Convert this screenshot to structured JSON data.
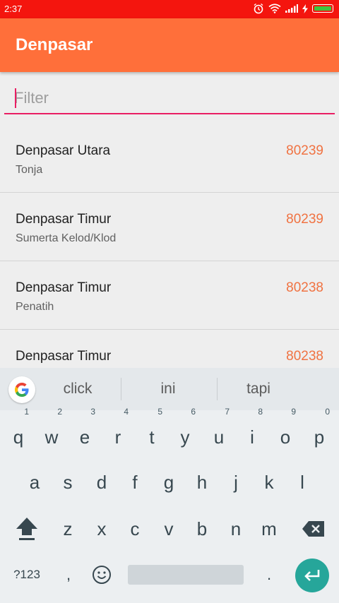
{
  "status": {
    "time": "2:37"
  },
  "appbar": {
    "title": "Denpasar"
  },
  "filter": {
    "placeholder": "Filter",
    "value": ""
  },
  "items": [
    {
      "title": "Denpasar Utara",
      "subtitle": "Tonja",
      "code": "80239"
    },
    {
      "title": "Denpasar Timur",
      "subtitle": "Sumerta Kelod/Klod",
      "code": "80239"
    },
    {
      "title": "Denpasar Timur",
      "subtitle": "Penatih",
      "code": "80238"
    },
    {
      "title": "Denpasar Timur",
      "subtitle": "",
      "code": "80238"
    }
  ],
  "keyboard": {
    "suggestions": [
      "click",
      "ini",
      "tapi"
    ],
    "row1": [
      {
        "k": "q",
        "n": "1"
      },
      {
        "k": "w",
        "n": "2"
      },
      {
        "k": "e",
        "n": "3"
      },
      {
        "k": "r",
        "n": "4"
      },
      {
        "k": "t",
        "n": "5"
      },
      {
        "k": "y",
        "n": "6"
      },
      {
        "k": "u",
        "n": "7"
      },
      {
        "k": "i",
        "n": "8"
      },
      {
        "k": "o",
        "n": "9"
      },
      {
        "k": "p",
        "n": "0"
      }
    ],
    "row2": [
      "a",
      "s",
      "d",
      "f",
      "g",
      "h",
      "j",
      "k",
      "l"
    ],
    "row3": [
      "z",
      "x",
      "c",
      "v",
      "b",
      "n",
      "m"
    ],
    "symbols_label": "?123",
    "comma": ",",
    "period": "."
  },
  "colors": {
    "statusbar": "#f4150e",
    "appbar": "#ff6f3a",
    "accent": "#e91e63",
    "code": "#f07241",
    "enter": "#26a69a"
  },
  "icons": [
    "alarm-icon",
    "wifi-icon",
    "signal-icon",
    "charging-icon",
    "battery-icon",
    "google-icon",
    "shift-icon",
    "backspace-icon",
    "emoji-icon",
    "enter-icon"
  ]
}
